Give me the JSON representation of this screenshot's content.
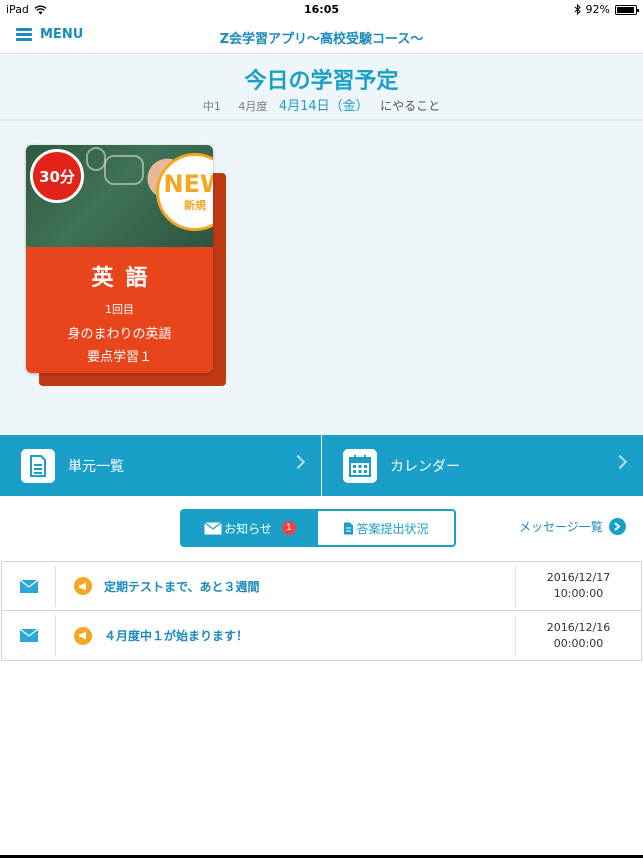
{
  "status_bar": {
    "device": "iPad",
    "time": "16:05",
    "battery_text": "92%",
    "battery_level": 0.92
  },
  "nav": {
    "menu_label": "MENU",
    "title": "Z会学習アプリ〜高校受験コース〜"
  },
  "study": {
    "title": "今日の学習予定",
    "grade": "中1",
    "month": "4月度",
    "date": "4月14日（金）",
    "suffix": "にやること"
  },
  "card": {
    "duration": "30分",
    "new_main": "NEW",
    "new_sub": "新規",
    "subject": "英語",
    "count": "1回目",
    "topic": "身のまわりの英語",
    "part": "要点学習１",
    "colors": {
      "card": "#e8451c",
      "badge_time": "#e2231a",
      "badge_new": "#f5a623"
    }
  },
  "buttons": {
    "units_label": "単元一覧",
    "calendar_label": "カレンダー",
    "accent": "#1a9fc8"
  },
  "tabs": {
    "notice_label": "お知らせ",
    "notice_count": "1",
    "submission_label": "答案提出状況"
  },
  "message_link": "メッセージ一覧",
  "notices": [
    {
      "title": "定期テストまで、あと３週間",
      "date": "2016/12/17",
      "time": "10:00:00"
    },
    {
      "title": "４月度中１が始まります！",
      "date": "2016/12/16",
      "time": "00:00:00"
    }
  ]
}
